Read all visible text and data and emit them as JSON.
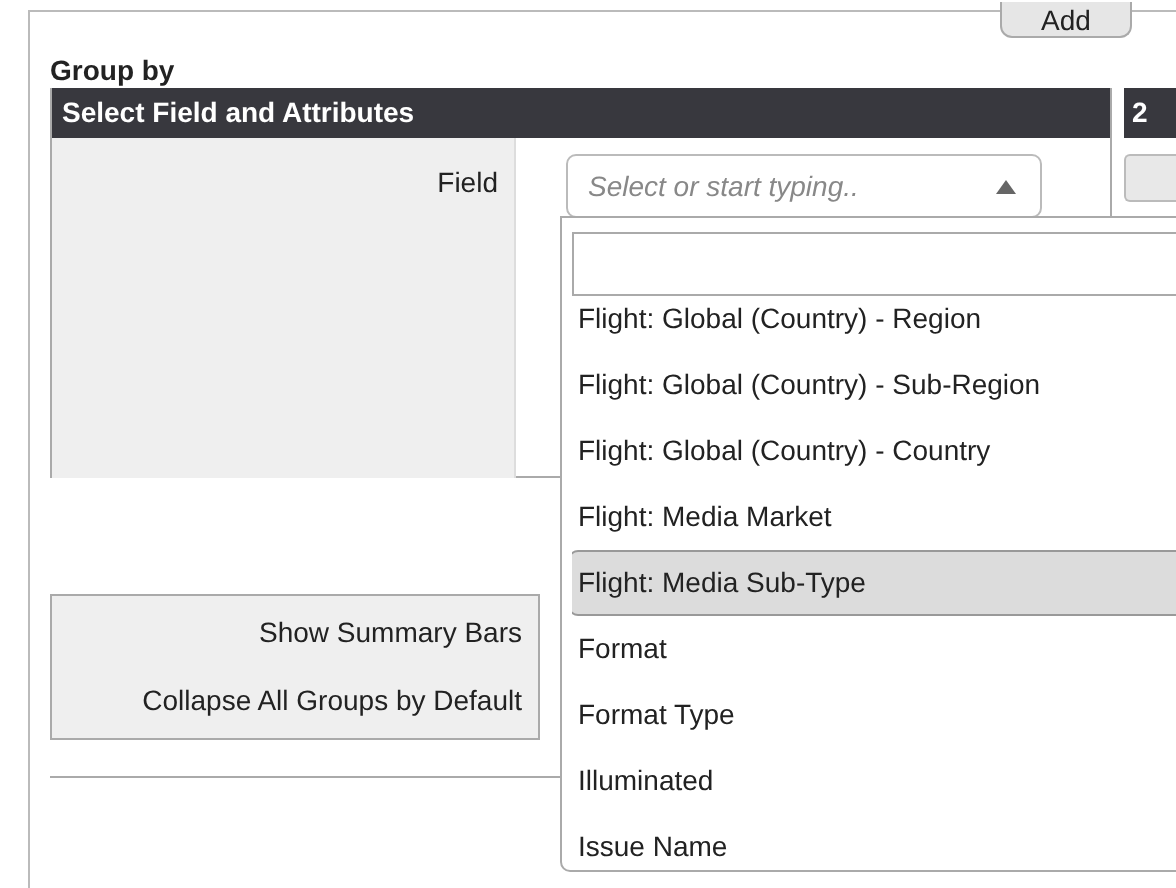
{
  "add_button": "Add",
  "section_title": "Group by",
  "panel": {
    "header": "Select Field and Attributes",
    "field_label": "Field",
    "field": {
      "placeholder": "Select or start typing..",
      "expanded": true
    }
  },
  "side_header": "2",
  "settings": [
    "Show Summary Bars",
    "Collapse All Groups by Default"
  ],
  "dropdown_options": [
    {
      "label": "Flight: Global (Country) - Region",
      "selected": false
    },
    {
      "label": "Flight: Global (Country) - Sub-Region",
      "selected": false
    },
    {
      "label": "Flight: Global (Country) - Country",
      "selected": false
    },
    {
      "label": "Flight: Media Market",
      "selected": false
    },
    {
      "label": "Flight: Media Sub-Type",
      "selected": true
    },
    {
      "label": "Format",
      "selected": false
    },
    {
      "label": "Format Type",
      "selected": false
    },
    {
      "label": "Illuminated",
      "selected": false
    },
    {
      "label": "Issue Name",
      "selected": false
    }
  ]
}
